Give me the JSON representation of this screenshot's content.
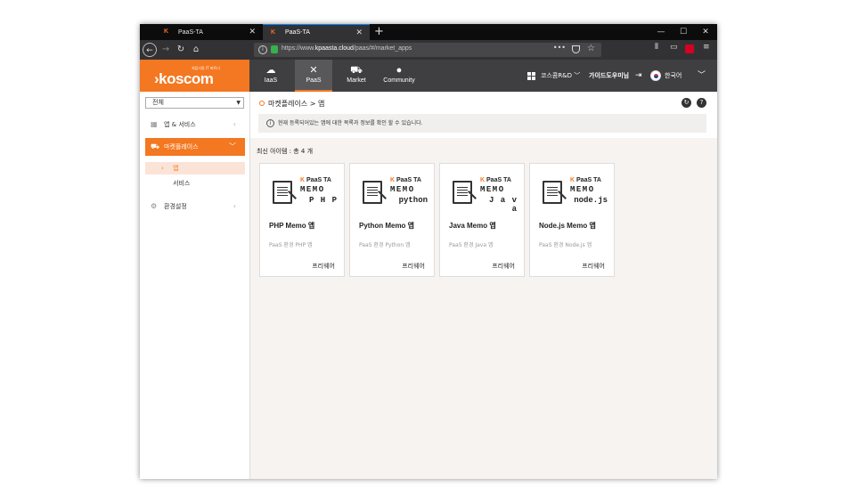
{
  "browser": {
    "tabs": [
      {
        "title": "PaaS-TA",
        "favicon": "K"
      },
      {
        "title": "PaaS-TA",
        "favicon": "K"
      }
    ],
    "url_prefix": "https://www.",
    "url_domain": "kpaasta.cloud",
    "url_path": "/paas/#/market_apps",
    "more": "•••",
    "icons": [
      "back-icon",
      "forward-icon",
      "reload-icon",
      "home-icon",
      "info-icon",
      "lock-icon",
      "pocket-icon",
      "star-icon",
      "library-icon",
      "sidebar-icon",
      "addon-icon",
      "menu-icon"
    ]
  },
  "header": {
    "logo_tag": "처음사랑 IT 파트너",
    "logo_text": "›koscom",
    "nav": [
      {
        "label": "IaaS",
        "icon": "cloud-icon"
      },
      {
        "label": "PaaS",
        "icon": "tools-icon"
      },
      {
        "label": "Market",
        "icon": "cart-icon"
      },
      {
        "label": "Community",
        "icon": "chat-icon"
      }
    ],
    "org": "코스콤R&D",
    "user": "가이드도우미님",
    "language": "한국어"
  },
  "sidebar": {
    "filter": "전체",
    "menus": [
      {
        "label": "앱 & 서비스",
        "icon": "apps-icon"
      },
      {
        "label": "마켓플레이스",
        "icon": "cart-icon"
      },
      {
        "label": "환경설정",
        "icon": "settings-icon"
      }
    ],
    "submenu": [
      "앱",
      "서비스"
    ]
  },
  "main": {
    "breadcrumb": "마켓플레이스 > 앱",
    "notice": "현재 등록되어있는 앱에 대한 목록과 정보를 확인 할 수 있습니다.",
    "count_label": "최신 아이템 : 총 4 개",
    "cards": [
      {
        "brand_k": "K",
        "brand": "PaaS TA",
        "memo": "MEMO",
        "lang": "P H P",
        "title": "PHP Memo 앱",
        "desc": "PaaS 환경 PHP 앱",
        "price": "프리웨어"
      },
      {
        "brand_k": "K",
        "brand": "PaaS TA",
        "memo": "MEMO",
        "lang": "python",
        "title": "Python Memo 앱",
        "desc": "PaaS 환경 Python 앱",
        "price": "프리웨어"
      },
      {
        "brand_k": "K",
        "brand": "PaaS TA",
        "memo": "MEMO",
        "lang": "J a v a",
        "title": "Java Memo 앱",
        "desc": "PaaS 환경 Java 앱",
        "price": "프리웨어"
      },
      {
        "brand_k": "K",
        "brand": "PaaS TA",
        "memo": "MEMO",
        "lang": "node.js",
        "title": "Node.js Memo 앱",
        "desc": "PaaS 환경 Node.js 앱",
        "price": "프리웨어"
      }
    ]
  },
  "colors": {
    "accent": "#f47721",
    "header_bg": "#3f3f41",
    "content_bg": "#f6f3f0"
  }
}
